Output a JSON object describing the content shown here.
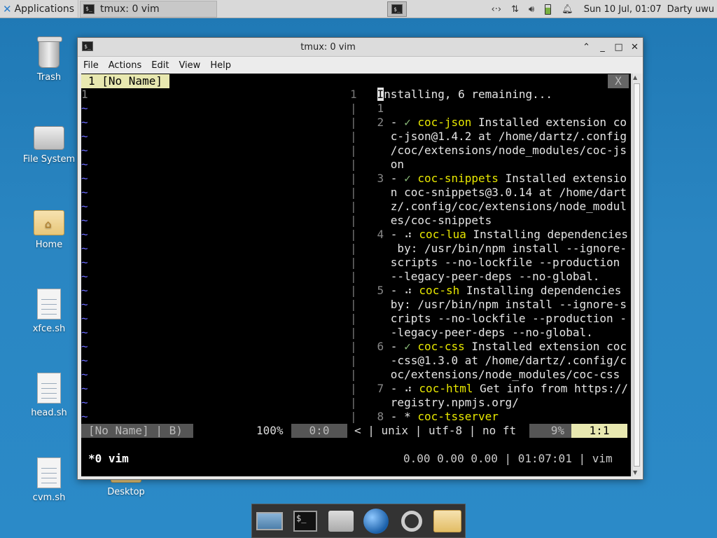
{
  "top_panel": {
    "applications_label": "Applications",
    "task_title": "tmux: 0 vim",
    "clock": "Sun 10 Jul, 01:07",
    "user": "Darty uwu"
  },
  "desktop": {
    "icons": [
      {
        "label": "Trash"
      },
      {
        "label": "File System"
      },
      {
        "label": "Home"
      },
      {
        "label": "xfce.sh"
      },
      {
        "label": "head.sh"
      },
      {
        "label": "cvm.sh"
      },
      {
        "label": "Desktop"
      }
    ]
  },
  "window": {
    "title": "tmux: 0 vim",
    "menu": [
      "File",
      "Actions",
      "Edit",
      "View",
      "Help"
    ]
  },
  "vim": {
    "tab_label": "1 [No Name]",
    "tab_close": "X",
    "left_first_line": "1",
    "right_lines": [
      {
        "num": "1",
        "parts": [
          [
            "Installing, 6 remaining...",
            "plain"
          ]
        ]
      },
      {
        "num": "1",
        "parts": []
      },
      {
        "num": "2",
        "parts": [
          [
            "- ",
            "plain"
          ],
          [
            "✓",
            "ok"
          ],
          [
            " ",
            "plain"
          ],
          [
            "coc-json",
            "ext"
          ],
          [
            " Installed extension co",
            "plain"
          ]
        ]
      },
      {
        "num": "",
        "parts": [
          [
            "c-json@1.4.2 at /home/dartz/.config",
            "plain"
          ]
        ]
      },
      {
        "num": "",
        "parts": [
          [
            "/coc/extensions/node_modules/coc-js",
            "plain"
          ]
        ]
      },
      {
        "num": "",
        "parts": [
          [
            "on",
            "plain"
          ]
        ]
      },
      {
        "num": "3",
        "parts": [
          [
            "- ",
            "plain"
          ],
          [
            "✓",
            "ok"
          ],
          [
            " ",
            "plain"
          ],
          [
            "coc-snippets",
            "ext"
          ],
          [
            " Installed extensio",
            "plain"
          ]
        ]
      },
      {
        "num": "",
        "parts": [
          [
            "n coc-snippets@3.0.14 at /home/dart",
            "plain"
          ]
        ]
      },
      {
        "num": "",
        "parts": [
          [
            "z/.config/coc/extensions/node_modul",
            "plain"
          ]
        ]
      },
      {
        "num": "",
        "parts": [
          [
            "es/coc-snippets",
            "plain"
          ]
        ]
      },
      {
        "num": "4",
        "parts": [
          [
            "- ⠴ ",
            "plain"
          ],
          [
            "coc-lua",
            "ext"
          ],
          [
            " Installing dependencies",
            "plain"
          ]
        ]
      },
      {
        "num": "",
        "parts": [
          [
            " by: /usr/bin/npm install --ignore-",
            "plain"
          ]
        ]
      },
      {
        "num": "",
        "parts": [
          [
            "scripts --no-lockfile --production ",
            "plain"
          ]
        ]
      },
      {
        "num": "",
        "parts": [
          [
            "--legacy-peer-deps --no-global.",
            "plain"
          ]
        ]
      },
      {
        "num": "5",
        "parts": [
          [
            "- ⠴ ",
            "plain"
          ],
          [
            "coc-sh",
            "ext"
          ],
          [
            " Installing dependencies",
            "plain"
          ]
        ]
      },
      {
        "num": "",
        "parts": [
          [
            "by: /usr/bin/npm install --ignore-s",
            "plain"
          ]
        ]
      },
      {
        "num": "",
        "parts": [
          [
            "cripts --no-lockfile --production -",
            "plain"
          ]
        ]
      },
      {
        "num": "",
        "parts": [
          [
            "-legacy-peer-deps --no-global.",
            "plain"
          ]
        ]
      },
      {
        "num": "6",
        "parts": [
          [
            "- ",
            "plain"
          ],
          [
            "✓",
            "ok"
          ],
          [
            " ",
            "plain"
          ],
          [
            "coc-css",
            "ext"
          ],
          [
            " Installed extension coc",
            "plain"
          ]
        ]
      },
      {
        "num": "",
        "parts": [
          [
            "-css@1.3.0 at /home/dartz/.config/c",
            "plain"
          ]
        ]
      },
      {
        "num": "",
        "parts": [
          [
            "oc/extensions/node_modules/coc-css",
            "plain"
          ]
        ]
      },
      {
        "num": "7",
        "parts": [
          [
            "- ⠴ ",
            "plain"
          ],
          [
            "coc-html",
            "ext"
          ],
          [
            " Get info from https://",
            "plain"
          ]
        ]
      },
      {
        "num": "",
        "parts": [
          [
            "registry.npmjs.org/",
            "plain"
          ]
        ]
      },
      {
        "num": "8",
        "parts": [
          [
            "- * ",
            "plain"
          ],
          [
            "coc-tsserver",
            "ext"
          ]
        ]
      }
    ],
    "status": {
      "left_name": "[No Name] | B)",
      "left_percent": "100%",
      "left_pos": "0:0",
      "right_info": "< | unix | utf-8 | no ft",
      "right_percent": "9%",
      "right_pos": "1:1"
    }
  },
  "tmux": {
    "window_label": "*0 vim",
    "right_info": "0.00 0.00 0.00 | 01:07:01 | vim"
  },
  "colors": {
    "tilde": "#6b6bff",
    "extension_name": "#e8e800",
    "ok_mark": "#8ec07c"
  }
}
